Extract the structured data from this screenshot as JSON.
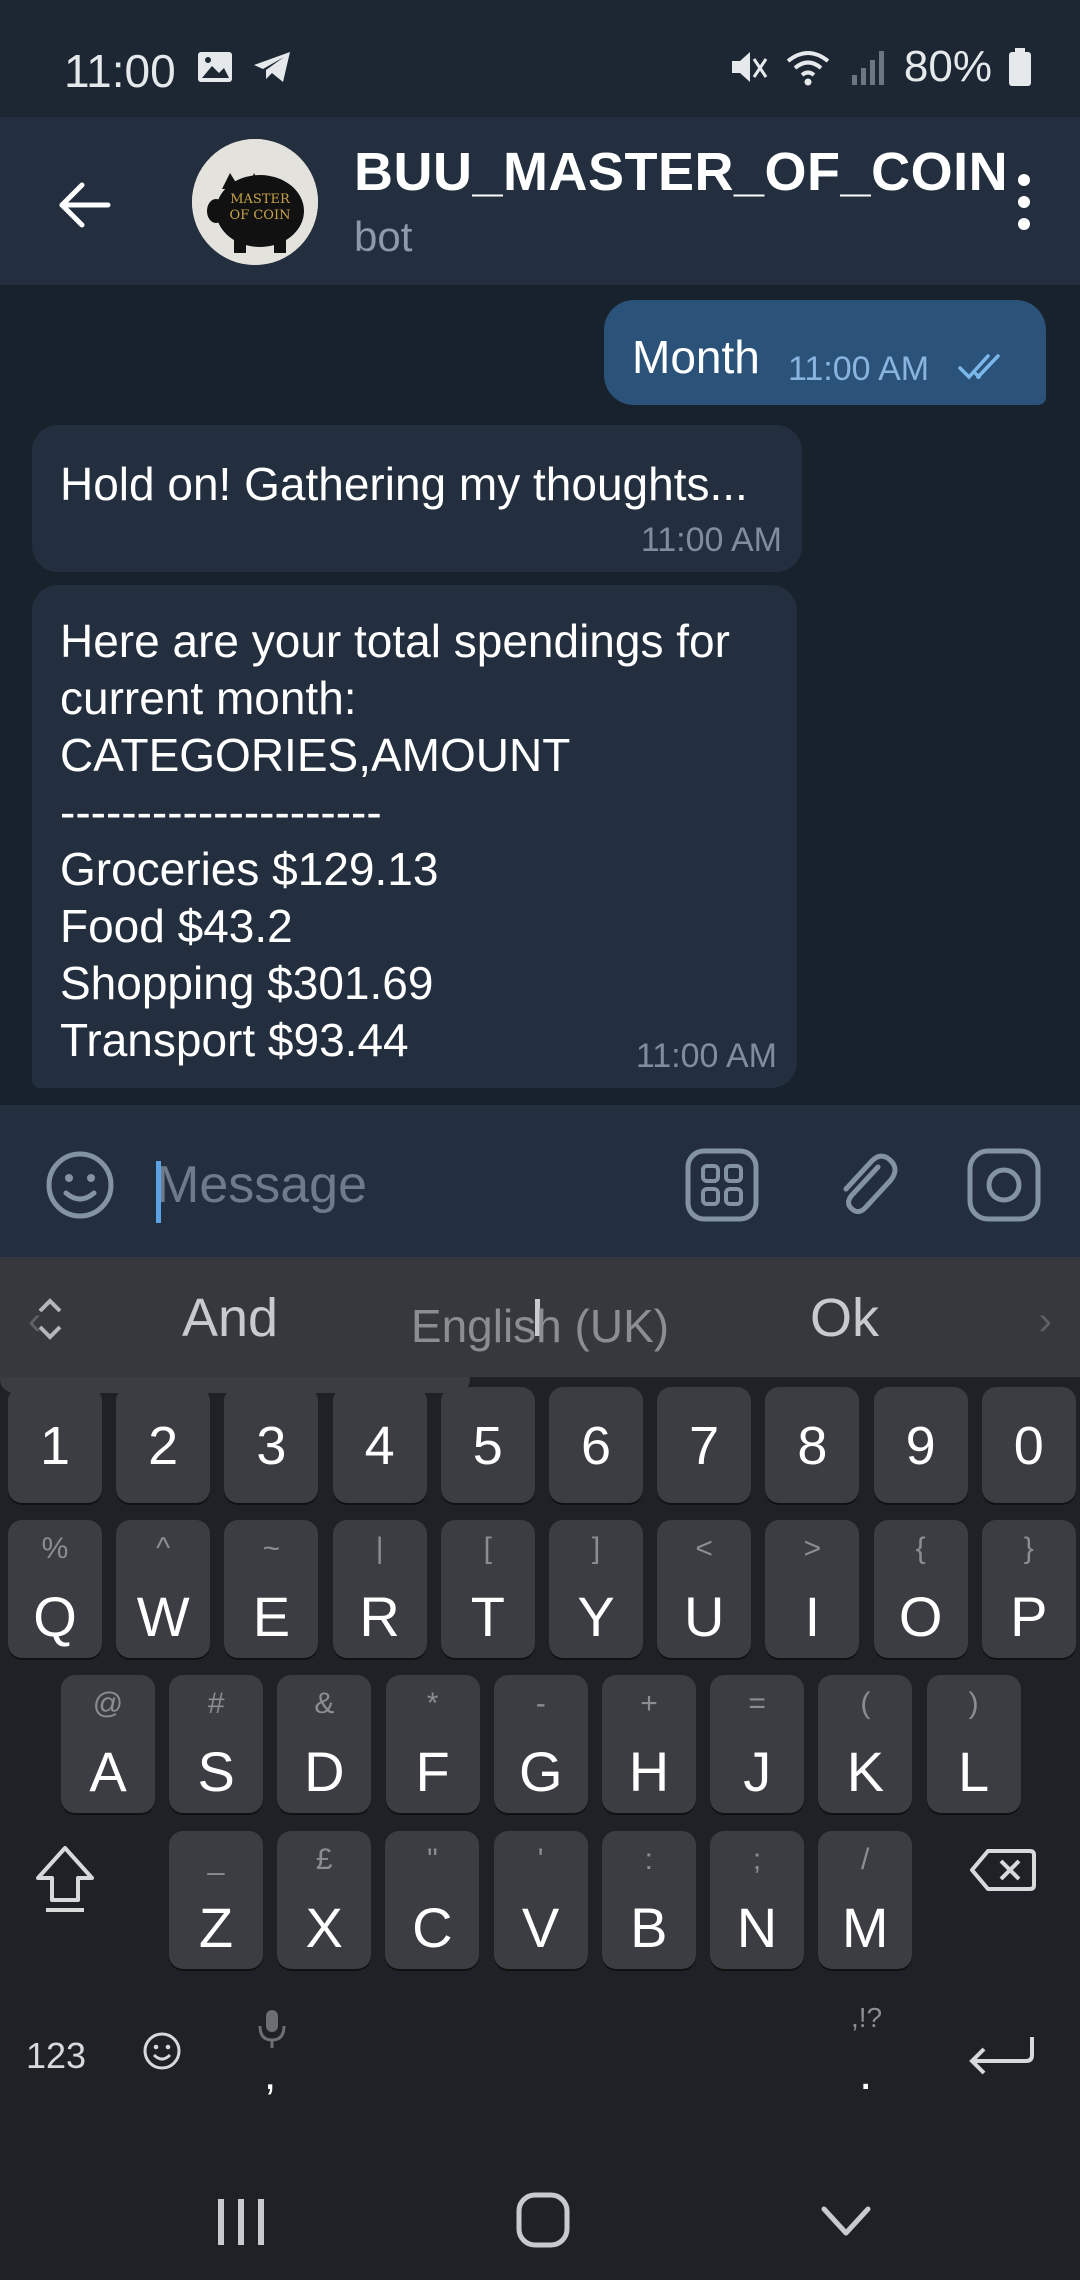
{
  "status_bar": {
    "time": "11:00",
    "battery": "80%"
  },
  "header": {
    "title": "BUU_MASTER_OF_COIN",
    "subtitle": "bot",
    "avatar_text": [
      "MASTER",
      "OF COIN"
    ]
  },
  "messages": {
    "outgoing": {
      "text": "Month",
      "time": "11:00 AM"
    },
    "incoming_1": {
      "text": "Hold on! Gathering my thoughts...",
      "time": "11:00 AM"
    },
    "incoming_2": {
      "lines": [
        "Here are your total spendings for",
        "current month:",
        "CATEGORIES,AMOUNT",
        "---------------------",
        "Groceries $129.13",
        "Food $43.2",
        "Shopping $301.69",
        "Transport $93.44"
      ],
      "time": "11:00 AM"
    }
  },
  "input_bar": {
    "placeholder": "Message"
  },
  "keyboard": {
    "suggestions": [
      "And",
      "I",
      "Ok"
    ],
    "number_row": [
      "1",
      "2",
      "3",
      "4",
      "5",
      "6",
      "7",
      "8",
      "9",
      "0"
    ],
    "row1": [
      {
        "main": "Q",
        "sub": "%"
      },
      {
        "main": "W",
        "sub": "^"
      },
      {
        "main": "E",
        "sub": "~"
      },
      {
        "main": "R",
        "sub": "|"
      },
      {
        "main": "T",
        "sub": "["
      },
      {
        "main": "Y",
        "sub": "]"
      },
      {
        "main": "U",
        "sub": "<"
      },
      {
        "main": "I",
        "sub": ">"
      },
      {
        "main": "O",
        "sub": "{"
      },
      {
        "main": "P",
        "sub": "}"
      }
    ],
    "row2": [
      {
        "main": "A",
        "sub": "@"
      },
      {
        "main": "S",
        "sub": "#"
      },
      {
        "main": "D",
        "sub": "&"
      },
      {
        "main": "F",
        "sub": "*"
      },
      {
        "main": "G",
        "sub": "-"
      },
      {
        "main": "H",
        "sub": "+"
      },
      {
        "main": "J",
        "sub": "="
      },
      {
        "main": "K",
        "sub": "("
      },
      {
        "main": "L",
        "sub": ")"
      }
    ],
    "row3": [
      {
        "main": "Z",
        "sub": "_"
      },
      {
        "main": "X",
        "sub": "£"
      },
      {
        "main": "C",
        "sub": "\""
      },
      {
        "main": "V",
        "sub": "'"
      },
      {
        "main": "B",
        "sub": ":"
      },
      {
        "main": "N",
        "sub": ";"
      },
      {
        "main": "M",
        "sub": "/"
      }
    ],
    "symbols_label": "123",
    "comma_label": ",",
    "space_label": "English (UK)",
    "period_label": ".",
    "period_sub": ",!?"
  },
  "colors": {
    "background": "#18222d",
    "header": "#232f3e",
    "outgoing_bubble": "#2b5278",
    "incoming_bubble": "#232f3e",
    "accent": "#5ca3e6",
    "keyboard": "#1f2127",
    "key": "#3b3d42"
  }
}
